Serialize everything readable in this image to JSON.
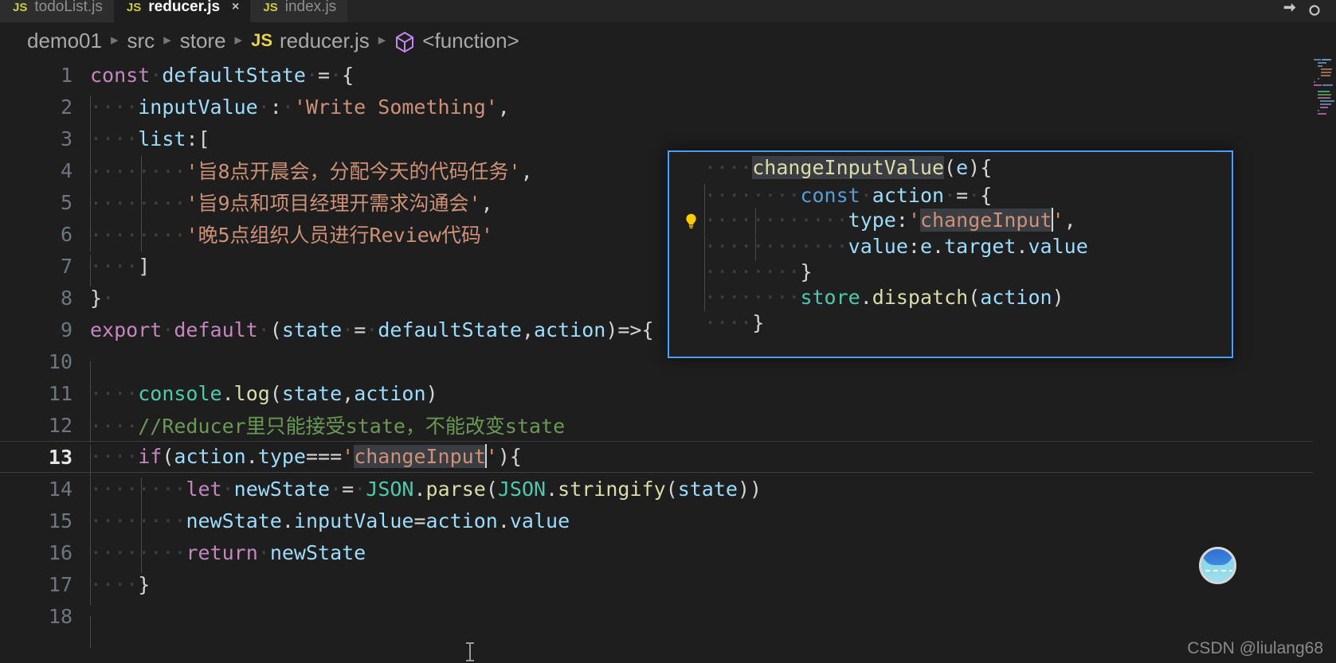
{
  "window": {
    "accent_color": "#0078d4",
    "overlay_border_color": "#4a9eff",
    "background": "#1e1e1e"
  },
  "tabs": [
    {
      "label": "todoList.js",
      "icon": "js-file-icon",
      "active": false,
      "close": ""
    },
    {
      "label": "reducer.js",
      "icon": "js-file-icon",
      "active": true,
      "close": "×"
    },
    {
      "label": "index.js",
      "icon": "js-file-icon",
      "active": false,
      "close": ""
    }
  ],
  "tabbar_actions": [
    {
      "name": "split-editor-icon"
    },
    {
      "name": "more-actions-icon"
    }
  ],
  "breadcrumb": {
    "segments": [
      "demo01",
      "src",
      "store",
      "reducer.js",
      "<function>"
    ],
    "separator": "▸",
    "js_badge": "JS",
    "symbol_icon": "cube-icon"
  },
  "editor": {
    "language": "javascript",
    "current_line": 13,
    "lines": [
      {
        "n": 1,
        "text": "const defaultState = {"
      },
      {
        "n": 2,
        "text": "    inputValue : 'Write Something',"
      },
      {
        "n": 3,
        "text": "    list:["
      },
      {
        "n": 4,
        "text": "        '旨8点开晨会，分配今天的代码任务',"
      },
      {
        "n": 5,
        "text": "        '旨9点和项目经理开需求沟通会',"
      },
      {
        "n": 6,
        "text": "        '晚5点组织人员进行Review代码'"
      },
      {
        "n": 7,
        "text": "    ]"
      },
      {
        "n": 8,
        "text": "}"
      },
      {
        "n": 9,
        "text": "export default (state = defaultState,action)=>{"
      },
      {
        "n": 10,
        "text": ""
      },
      {
        "n": 11,
        "text": "    console.log(state,action)"
      },
      {
        "n": 12,
        "text": "    //Reducer里只能接受state，不能改变state"
      },
      {
        "n": 13,
        "text": "    if(action.type==='changeInput'){"
      },
      {
        "n": 14,
        "text": "        let newState = JSON.parse(JSON.stringify(state))"
      },
      {
        "n": 15,
        "text": "        newState.inputValue=action.value"
      },
      {
        "n": 16,
        "text": "        return newState"
      },
      {
        "n": 17,
        "text": "    }"
      },
      {
        "n": 18,
        "text": ""
      }
    ],
    "selected_word": "changeInput"
  },
  "overlay": {
    "title_symbol": "changeInputValue",
    "hint_icon": "lightbulb-icon",
    "lines": [
      "    changeInputValue(e){",
      "        const action = {",
      "            type:'changeInput',",
      "            value:e.target.value",
      "        }",
      "        store.dispatch(action)",
      "    }"
    ],
    "highlighted_word": "changeInput"
  },
  "tokens": {
    "const": "const",
    "defaultState": "defaultState",
    "inputValue": "inputValue",
    "write_something": "'Write Something'",
    "list": "list",
    "task1": "'旨8点开晨会，分配今天的代码任务'",
    "task2": "'旨9点和项目经理开需求沟通会'",
    "task3": "'晚5点组织人员进行Review代码'",
    "export": "export",
    "default": "default",
    "state": "state",
    "action": "action",
    "console": "console",
    "log": "log",
    "comment12": "//Reducer里只能接受state，不能改变state",
    "if": "if",
    "changeInput": "changeInput",
    "let": "let",
    "newState": "newState",
    "JSON": "JSON",
    "parse": "parse",
    "stringify": "stringify",
    "return": "return",
    "changeInputValue": "changeInputValue",
    "e": "e",
    "type": "type",
    "value": "value",
    "target": "target",
    "store": "store",
    "dispatch": "dispatch"
  },
  "footer": {
    "watermark": "CSDN @liulang68"
  },
  "avatar": {
    "name": "user-avatar"
  }
}
